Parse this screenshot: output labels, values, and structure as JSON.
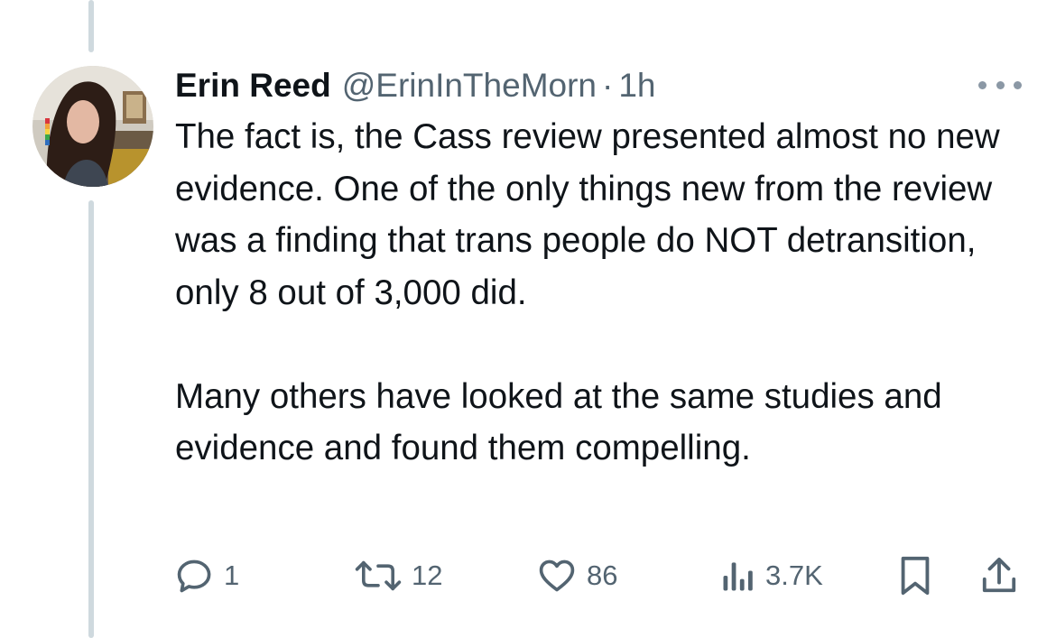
{
  "author": {
    "display_name": "Erin Reed",
    "handle": "@ErinInTheMorn",
    "separator": "·",
    "time": "1h"
  },
  "tweet": {
    "paragraph_1": "The fact is, the Cass review presented almost no new evidence. One of the only things new from the review was a finding that trans people do NOT detransition, only 8 out of 3,000 did.",
    "paragraph_2": "Many others have looked at the same studies and evidence and found them compelling."
  },
  "actions": {
    "replies": "1",
    "reposts": "12",
    "likes": "86",
    "views": "3.7K"
  },
  "icons": {
    "reply": "reply-icon",
    "repost": "repost-icon",
    "like": "heart-icon",
    "views": "views-icon",
    "bookmark": "bookmark-icon",
    "share": "share-icon",
    "more": "more-icon"
  },
  "colors": {
    "text": "#0f1419",
    "secondary": "#536471",
    "thread_line": "#cfd9de"
  }
}
